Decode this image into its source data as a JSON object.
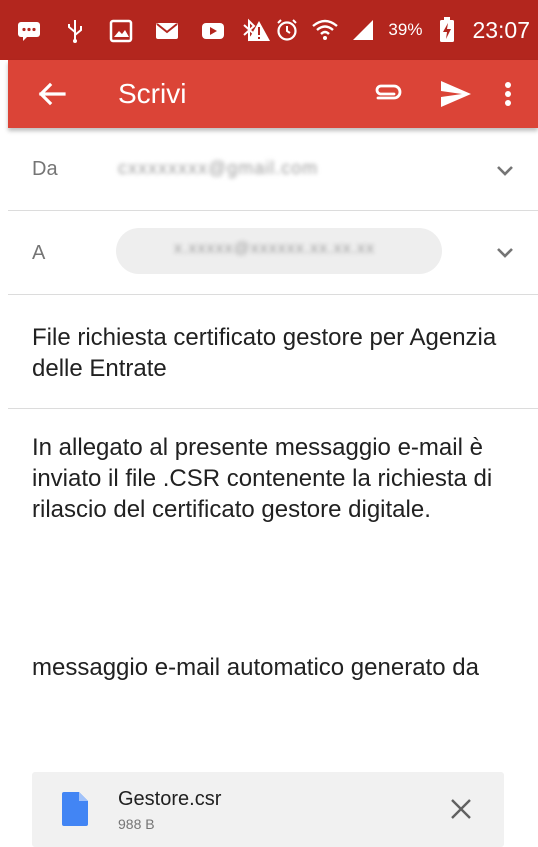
{
  "status_bar": {
    "icons": [
      "chat-icon",
      "usb-icon",
      "image-icon",
      "mail-icon",
      "video-icon",
      "warning-icon",
      "bluetooth-icon",
      "alarm-icon",
      "wifi-icon",
      "signal-icon",
      "battery-charging-icon"
    ],
    "battery": "39%",
    "time": "23:07"
  },
  "toolbar": {
    "title": "Scrivi",
    "color": "#db4437"
  },
  "compose": {
    "from_label": "Da",
    "from_value": "cxxxxxxxx@gmail.com",
    "to_label": "A",
    "to_value": "x.xxxxx@xxxxxx.xx.xx.xx",
    "subject": "File richiesta certificato gestore per Agenzia delle Entrate",
    "body": "In allegato al presente messaggio e-mail è inviato il file .CSR contenente la richiesta di rilascio del certificato gestore digitale.",
    "body_auto": "messaggio e-mail automatico generato da"
  },
  "attachment": {
    "name": "Gestore.csr",
    "size": "988 B",
    "icon_color": "#4285f4"
  }
}
